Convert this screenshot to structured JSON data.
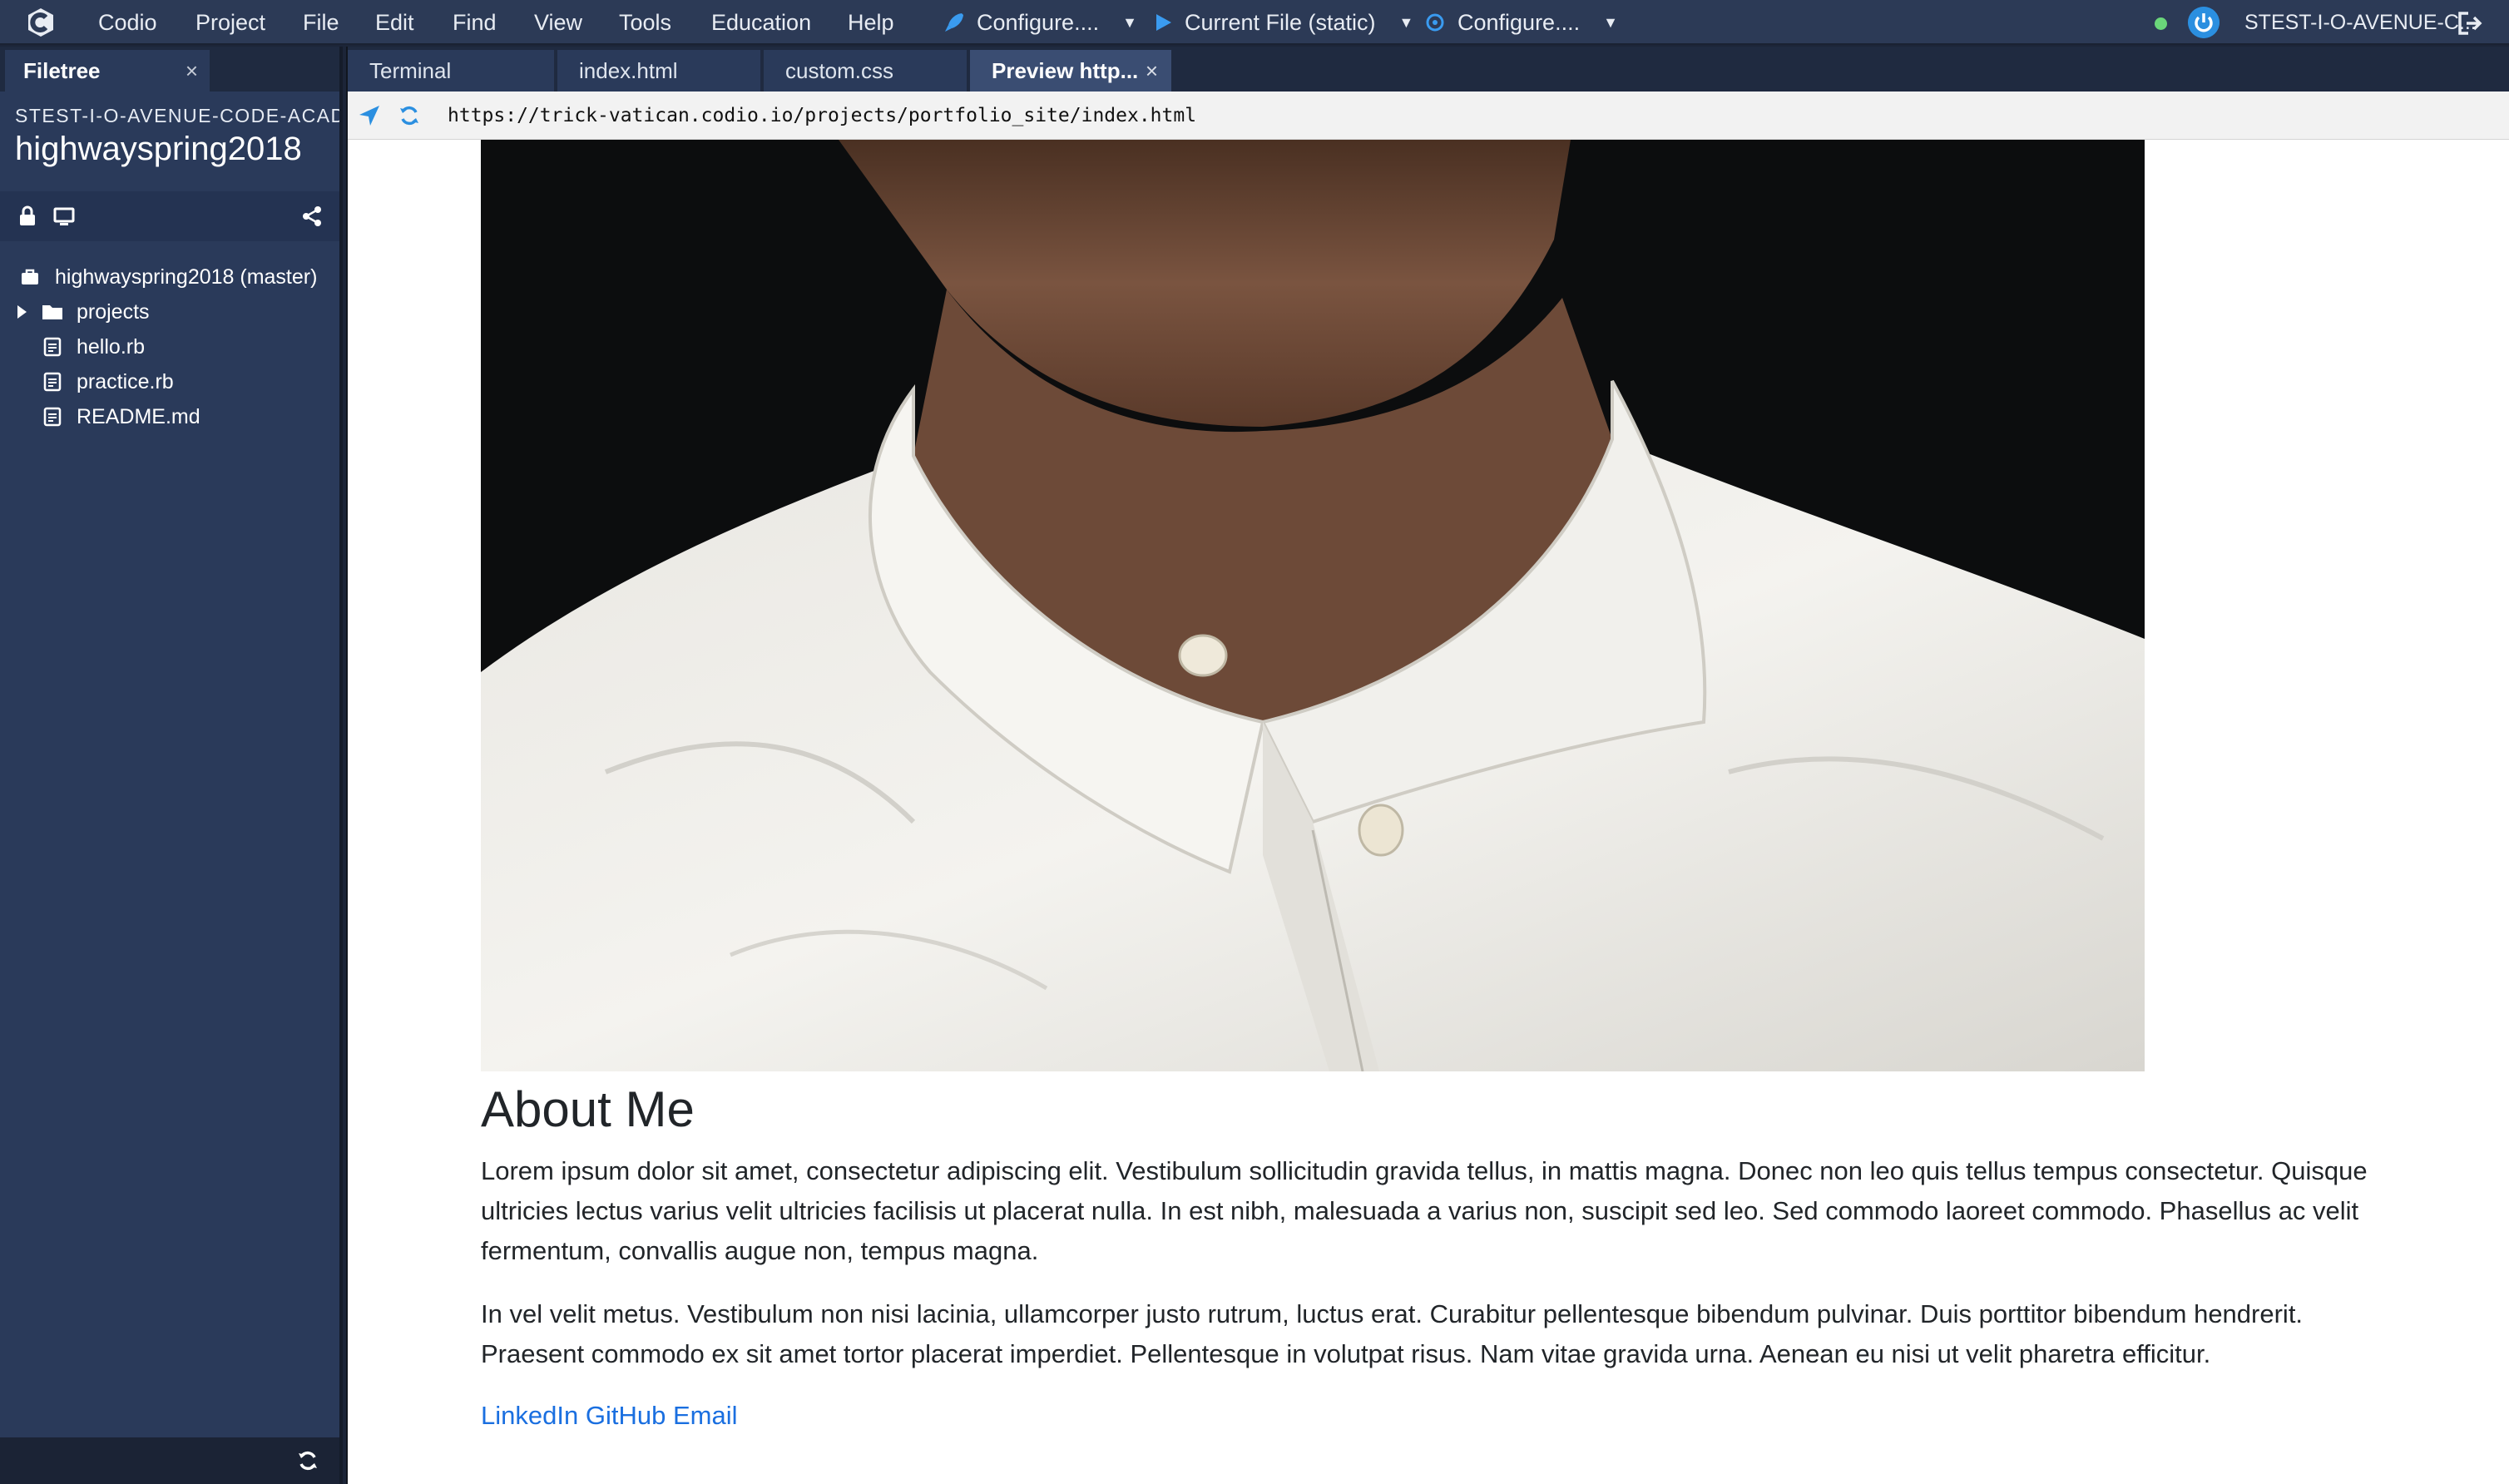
{
  "menubar": {
    "items": [
      "Codio",
      "Project",
      "File",
      "Edit",
      "Find",
      "View",
      "Tools",
      "Education",
      "Help"
    ],
    "runners": [
      "Configure....",
      "Current File (static)",
      "Configure...."
    ],
    "user": "STEST-I-O-AVENUE-C...",
    "colors": {
      "bar": "#2c3a56",
      "status": "#6ad67a",
      "accent": "#2b8fe0"
    }
  },
  "sidebar": {
    "tab_label": "Filetree",
    "tab_close": "×",
    "org": "STEST-I-O-AVENUE-CODE-ACADEMY",
    "project": "highwayspring2018",
    "tree": [
      {
        "label": "highwayspring2018 (master)",
        "icon": "briefcase-icon"
      },
      {
        "label": "projects",
        "icon": "folder-icon"
      },
      {
        "label": "hello.rb",
        "icon": "file-icon"
      },
      {
        "label": "practice.rb",
        "icon": "file-icon"
      },
      {
        "label": "README.md",
        "icon": "file-icon"
      }
    ]
  },
  "tabs": [
    {
      "label": "Terminal"
    },
    {
      "label": "index.html"
    },
    {
      "label": "custom.css"
    },
    {
      "label": "Preview http...",
      "close": "×"
    }
  ],
  "urlbar": {
    "url": "https://trick-vatican.codio.io/projects/portfolio_site/index.html"
  },
  "preview": {
    "heading": "About Me",
    "para1": "Lorem ipsum dolor sit amet, consectetur adipiscing elit. Vestibulum sollicitudin gravida tellus, in mattis magna. Donec non leo quis tellus tempus consectetur. Quisque ultricies lectus varius velit ultricies facilisis ut placerat nulla. In est nibh, malesuada a varius non, suscipit sed leo. Sed commodo laoreet commodo. Phasellus ac velit fermentum, convallis augue non, tempus magna.",
    "para2": "In vel velit metus. Vestibulum non nisi lacinia, ullamcorper justo rutrum, luctus erat. Curabitur pellentesque bibendum pulvinar. Duis porttitor bibendum hendrerit. Praesent commodo ex sit amet tortor placerat imperdiet. Pellentesque in volutpat risus. Nam vitae gravida urna. Aenean eu nisi ut velit pharetra efficitur.",
    "links": [
      "LinkedIn",
      "GitHub",
      "Email"
    ],
    "colors": {
      "text": "#212529",
      "link": "#1a6fe0"
    }
  }
}
